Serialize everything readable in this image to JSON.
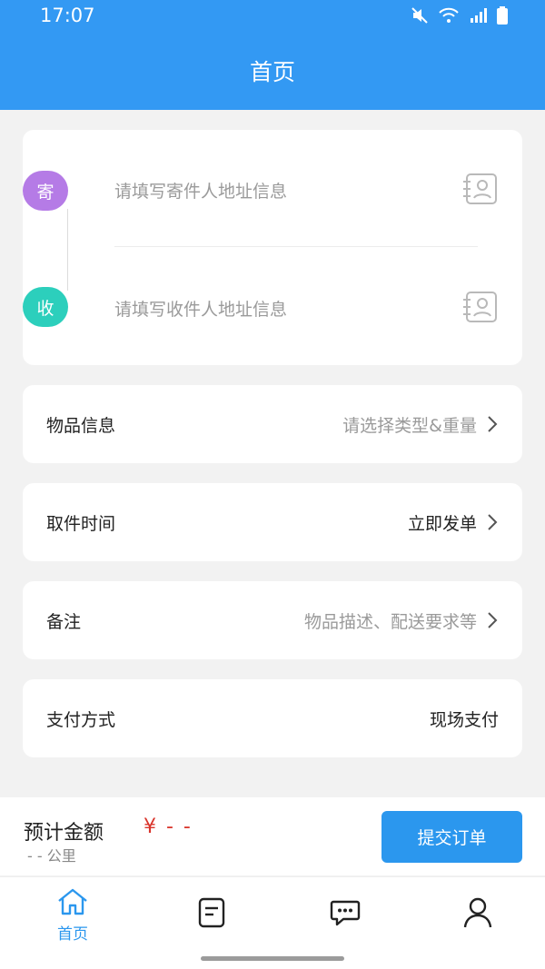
{
  "status_bar": {
    "time": "17:07"
  },
  "header": {
    "title": "首页"
  },
  "address": {
    "sender_badge": "寄",
    "sender_placeholder": "请填写寄件人地址信息",
    "receiver_badge": "收",
    "receiver_placeholder": "请填写收件人地址信息"
  },
  "rows": [
    {
      "label": "物品信息",
      "value": "请选择类型&重量"
    },
    {
      "label": "取件时间",
      "value": "立即发单"
    },
    {
      "label": "备注",
      "value": "物品描述、配送要求等"
    },
    {
      "label": "支付方式",
      "value": "现场支付"
    }
  ],
  "order": {
    "estimate_label": "预计金额",
    "price": "¥ - -",
    "distance": "- - 公里",
    "submit_label": "提交订单"
  },
  "tabs": [
    {
      "label": "首页",
      "icon": "home-icon"
    },
    {
      "icon": "orders-icon"
    },
    {
      "icon": "message-icon"
    },
    {
      "icon": "user-icon"
    }
  ],
  "colors": {
    "primary": "#3399f3",
    "sender_badge": "#b57be6",
    "receiver_badge": "#2ccfbc",
    "price": "#d9342b"
  }
}
